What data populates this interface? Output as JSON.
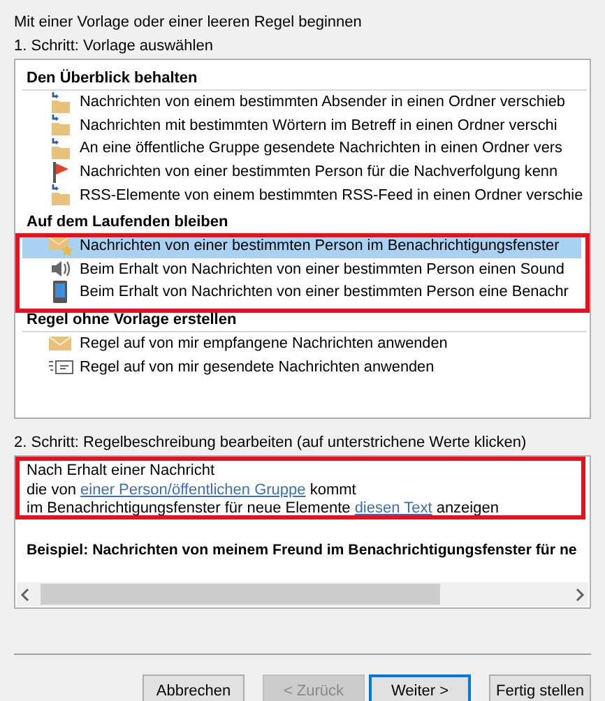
{
  "heading": "Mit einer Vorlage oder einer leeren Regel beginnen",
  "step1": {
    "label": "1. Schritt: Vorlage auswählen",
    "groups": [
      {
        "title": "Den Überblick behalten",
        "items": [
          {
            "kind": "move",
            "label": "Nachrichten von einem bestimmten Absender in einen Ordner verschieb",
            "selected": false
          },
          {
            "kind": "move",
            "label": "Nachrichten mit bestimmten Wörtern im Betreff in einen Ordner verschi",
            "selected": false
          },
          {
            "kind": "move",
            "label": "An eine öffentliche Gruppe gesendete Nachrichten in einen Ordner vers",
            "selected": false
          },
          {
            "kind": "flag",
            "label": "Nachrichten von einer bestimmten Person für die Nachverfolgung kenn",
            "selected": false
          },
          {
            "kind": "move",
            "label": "RSS-Elemente von einem bestimmten RSS-Feed in einen Ordner verschie",
            "selected": false
          }
        ]
      },
      {
        "title": "Auf dem Laufenden bleiben",
        "items": [
          {
            "kind": "alert",
            "label": "Nachrichten von einer bestimmten Person im Benachrichtigungsfenster",
            "selected": true
          },
          {
            "kind": "sound",
            "label": "Beim Erhalt von Nachrichten von einer bestimmten Person einen Sound",
            "selected": false
          },
          {
            "kind": "mobile",
            "label": "Beim Erhalt von Nachrichten von einer bestimmten Person eine Benachr",
            "selected": false
          }
        ]
      },
      {
        "title": "Regel ohne Vorlage erstellen",
        "items": [
          {
            "kind": "received",
            "label": "Regel auf von mir empfangene Nachrichten anwenden",
            "selected": false
          },
          {
            "kind": "sent",
            "label": "Regel auf von mir gesendete Nachrichten anwenden",
            "selected": false
          }
        ]
      }
    ]
  },
  "step2": {
    "label": "2. Schritt: Regelbeschreibung bearbeiten (auf unterstrichene Werte klicken)",
    "lines": [
      [
        {
          "text": "Nach Erhalt einer Nachricht"
        }
      ],
      [
        {
          "text": "die von "
        },
        {
          "link": "einer Person/öffentlichen Gruppe"
        },
        {
          "text": " kommt"
        }
      ],
      [
        {
          "text": "im Benachrichtigungsfenster für neue Elemente "
        },
        {
          "link": "diesen Text"
        },
        {
          "text": " anzeigen"
        }
      ]
    ],
    "example": "Beispiel: Nachrichten von meinem Freund im Benachrichtigungsfenster für ne"
  },
  "buttons": [
    {
      "label": "Abbrechen",
      "disabled": false,
      "focused": false
    },
    {
      "label": "< Zurück",
      "disabled": true,
      "focused": false
    },
    {
      "label": "Weiter >",
      "disabled": false,
      "focused": true
    },
    {
      "label": "Fertig stellen",
      "disabled": false,
      "focused": false
    }
  ]
}
